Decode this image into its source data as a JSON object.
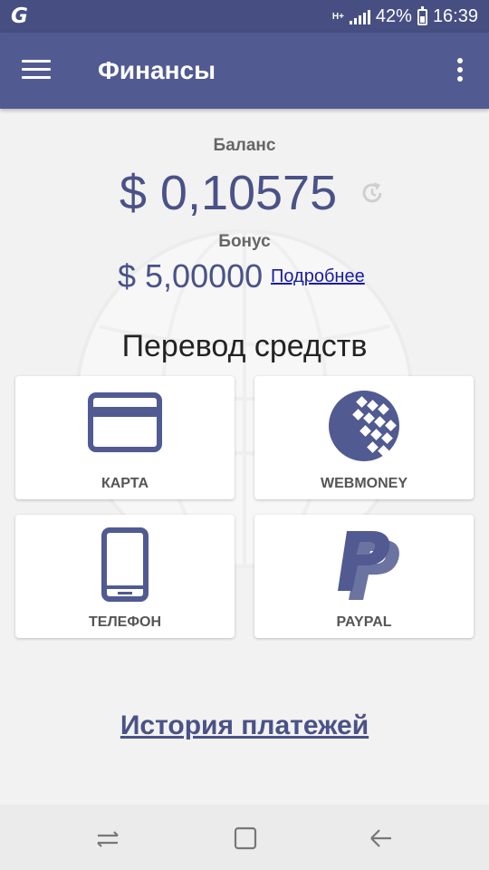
{
  "status_bar": {
    "app_icon": "G",
    "network": "H+",
    "battery": "42%",
    "time": "16:39"
  },
  "app_bar": {
    "title": "Финансы",
    "menu_icon": "hamburger-icon",
    "more_icon": "more-vert-icon"
  },
  "balance": {
    "label": "Баланс",
    "value": "$ 0,10575"
  },
  "bonus": {
    "label": "Бонус",
    "value": "$ 5,00000",
    "link": "Подробнее"
  },
  "transfer": {
    "title": "Перевод средств",
    "methods": [
      {
        "label": "КАРТА",
        "icon": "credit-card-icon"
      },
      {
        "label": "WEBMONEY",
        "icon": "webmoney-icon"
      },
      {
        "label": "ТЕЛЕФОН",
        "icon": "phone-icon"
      },
      {
        "label": "PAYPAL",
        "icon": "paypal-icon"
      }
    ]
  },
  "history": {
    "link": "История платежей"
  },
  "colors": {
    "accent": "#515a91",
    "status_bar": "#474f82",
    "text_value": "#4a5288",
    "link": "#1a1aa6"
  }
}
